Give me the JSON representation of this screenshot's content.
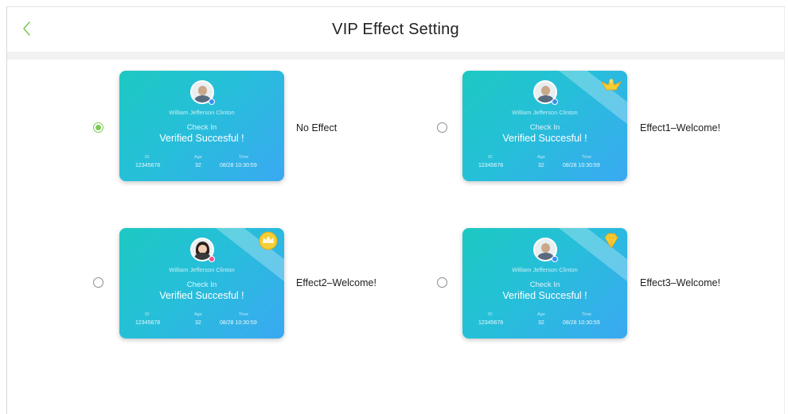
{
  "header": {
    "title": "VIP Effect Setting",
    "back_icon": "chevron-left-icon"
  },
  "colors": {
    "accent": "#7acb56",
    "card_gradient_start": "#1cc9c2",
    "card_gradient_end": "#3aa9f2",
    "ribbon_text": "#f6d24a"
  },
  "card": {
    "name": "William Jefferson Clinton",
    "status": "Check In",
    "result": "Verified Succesful !",
    "id_label": "ID",
    "id_value": "12345678",
    "age_label": "Age",
    "age_value": "32",
    "time_label": "Time",
    "time_value": "08/28  10:30:59"
  },
  "options": [
    {
      "label": "No Effect",
      "selected": true,
      "effect_icon": ""
    },
    {
      "label": "Effect1–Welcome!",
      "selected": false,
      "effect_icon": "eagle-icon"
    },
    {
      "label": "Effect2–Welcome!",
      "selected": false,
      "effect_icon": "crown-icon"
    },
    {
      "label": "Effect3–Welcome!",
      "selected": false,
      "effect_icon": "diamond-icon"
    }
  ]
}
